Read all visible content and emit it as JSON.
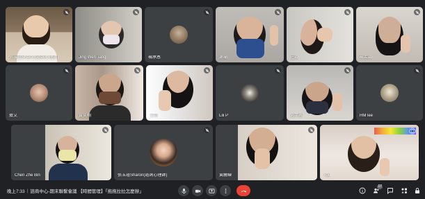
{
  "participants": [
    {
      "name": "張玉瑄Sharon(諮詢心理師)",
      "muted": true
    },
    {
      "name": "Jing Wen Tang",
      "muted": true
    },
    {
      "name": "楊承恩",
      "muted": true
    },
    {
      "name": "謝瑜",
      "muted": true
    },
    {
      "name": "莊穎",
      "muted": true
    },
    {
      "name": "楊若穎",
      "muted": true
    },
    {
      "name": "敖艾",
      "muted": true
    },
    {
      "name": "黃奕翔",
      "muted": true
    },
    {
      "name": "王翊",
      "muted": true
    },
    {
      "name": "Lili P",
      "muted": true
    },
    {
      "name": "何芊蕙",
      "muted": true
    },
    {
      "name": "HM lee",
      "muted": true
    },
    {
      "name": "Chen Zhe Bin",
      "muted": true
    },
    {
      "name": "張玉瑄Sharon(諮詢心理師)",
      "muted": true
    },
    {
      "name": "黃騰嶸",
      "muted": true
    },
    {
      "name": "You",
      "muted": false
    }
  ],
  "meeting": {
    "time": "晚上7:33",
    "title": "諮商中心-期末聯繫會議 【時間管理】「拖拖拉拉怎麼辦」"
  },
  "controls": {
    "mic": "mic-icon",
    "camera": "camera-icon",
    "present": "present-icon",
    "more": "more-options-icon",
    "end": "end-call-icon"
  },
  "side": {
    "participants_count": "17"
  },
  "colors": {
    "end_call": "#ea4335",
    "highlight": "#8ab4f8",
    "tile": "#3c4043"
  }
}
